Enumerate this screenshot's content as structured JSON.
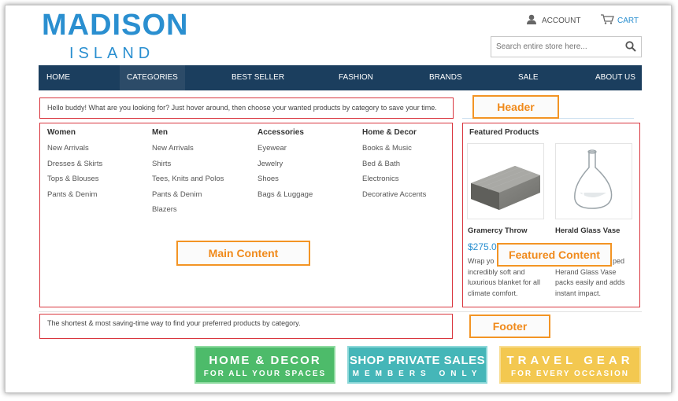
{
  "logo": {
    "main": "MADISON",
    "sub": "ISLAND"
  },
  "account": {
    "label": "ACCOUNT",
    "icon": "user-icon"
  },
  "cart": {
    "label": "CART",
    "icon": "cart-icon"
  },
  "search": {
    "placeholder": "Search entire store here...",
    "icon": "search-icon"
  },
  "nav": {
    "items": [
      {
        "label": "HOME"
      },
      {
        "label": "CATEGORIES"
      },
      {
        "label": "BEST SELLER"
      },
      {
        "label": "FASHION"
      },
      {
        "label": "BRANDS"
      },
      {
        "label": "SALE"
      },
      {
        "label": "ABOUT US"
      }
    ]
  },
  "header_message": "Hello buddy! What are you looking for? Just hover around, then choose your wanted products by category to save your time.",
  "categories": [
    {
      "title": "Women",
      "items": [
        "New Arrivals",
        "Dresses & Skirts",
        "Tops & Blouses",
        "Pants & Denim"
      ]
    },
    {
      "title": "Men",
      "items": [
        "New Arrivals",
        "Shirts",
        "Tees, Knits and Polos",
        "Pants & Denim",
        "Blazers"
      ]
    },
    {
      "title": "Accessories",
      "items": [
        "Eyewear",
        "Jewelry",
        "Shoes",
        "Bags & Luggage"
      ]
    },
    {
      "title": "Home & Decor",
      "items": [
        "Books & Music",
        "Bed & Bath",
        "Electronics",
        "Decorative Accents"
      ]
    }
  ],
  "featured": {
    "title": "Featured Products",
    "products": [
      {
        "name": "Gramercy Throw",
        "price": "$275.0",
        "desc": [
          "Wrap yo",
          "incredibly soft and",
          "luxurious blanket for all",
          "climate comfort."
        ]
      },
      {
        "name": "Herald Glass Vase",
        "desc": [
          "ped",
          "Herand Glass Vase",
          "packs easily and adds",
          "instant impact."
        ]
      }
    ]
  },
  "footer_message": "The shortest & most saving-time way to find your preferred products by category.",
  "annotations": {
    "header": "Header",
    "main": "Main Content",
    "featured": "Featured Content",
    "footer": "Footer"
  },
  "banners": [
    {
      "line1": "HOME & DECOR",
      "line2": "FOR ALL YOUR SPACES",
      "color": "#4dbb6a"
    },
    {
      "line1": "SHOP PRIVATE SALES",
      "line2": "MEMBERS ONLY",
      "color": "#45b6b8"
    },
    {
      "line1": "TRAVEL GEAR",
      "line2": "FOR EVERY OCCASION",
      "color": "#f3c850"
    }
  ],
  "colors": {
    "accent": "#2a8fd0",
    "nav_bg": "#1b3e5e",
    "annotation_red": "#d9363e",
    "annotation_orange": "#f39424"
  }
}
